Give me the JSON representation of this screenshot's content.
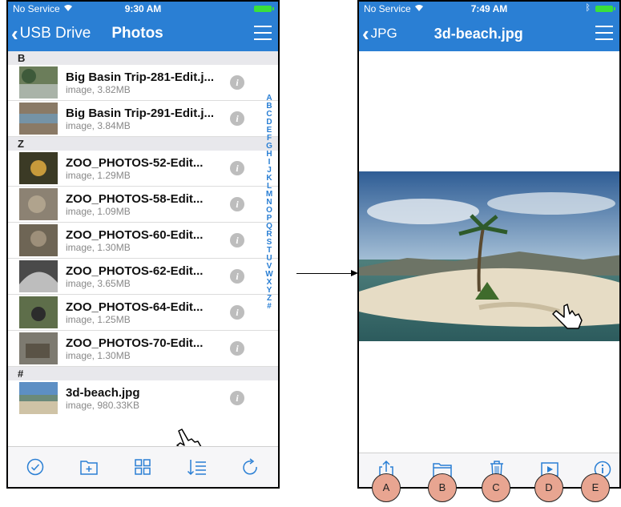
{
  "left_screen": {
    "status": {
      "carrier": "No Service",
      "time": "9:30 AM"
    },
    "nav": {
      "back_label": "USB Drive",
      "title": "Photos"
    },
    "sections": [
      {
        "header": "B",
        "items": [
          {
            "name": "Big Basin Trip-281-Edit.j...",
            "meta": "image, 3.82MB"
          },
          {
            "name": "Big Basin Trip-291-Edit.j...",
            "meta": "image, 3.84MB"
          }
        ]
      },
      {
        "header": "Z",
        "items": [
          {
            "name": "ZOO_PHOTOS-52-Edit...",
            "meta": "image, 1.29MB"
          },
          {
            "name": "ZOO_PHOTOS-58-Edit...",
            "meta": "image, 1.09MB"
          },
          {
            "name": "ZOO_PHOTOS-60-Edit...",
            "meta": "image, 1.30MB"
          },
          {
            "name": "ZOO_PHOTOS-62-Edit...",
            "meta": "image, 3.65MB"
          },
          {
            "name": "ZOO_PHOTOS-64-Edit...",
            "meta": "image, 1.25MB"
          },
          {
            "name": "ZOO_PHOTOS-70-Edit...",
            "meta": "image, 1.30MB"
          }
        ]
      },
      {
        "header": "#",
        "items": [
          {
            "name": "3d-beach.jpg",
            "meta": "image, 980.33KB"
          }
        ]
      }
    ],
    "index_letters": [
      "A",
      "B",
      "C",
      "D",
      "E",
      "F",
      "G",
      "H",
      "I",
      "J",
      "K",
      "L",
      "M",
      "N",
      "O",
      "P",
      "Q",
      "R",
      "S",
      "T",
      "U",
      "V",
      "W",
      "X",
      "Y",
      "Z",
      "#"
    ],
    "toolbar_icons": [
      "checkmark-circle-icon",
      "new-folder-icon",
      "grid-view-icon",
      "sort-icon",
      "refresh-icon"
    ]
  },
  "right_screen": {
    "status": {
      "carrier": "No Service",
      "time": "7:49 AM"
    },
    "nav": {
      "back_label": "JPG",
      "title": "3d-beach.jpg"
    },
    "toolbar_icons": [
      "share-icon",
      "folder-icon",
      "trash-icon",
      "play-icon",
      "info-icon"
    ]
  },
  "callouts": [
    "A",
    "B",
    "C",
    "D",
    "E"
  ],
  "colors": {
    "nav_blue": "#2a7fd4",
    "callout_fill": "#e8a591",
    "index_blue": "#2a7fd4"
  }
}
